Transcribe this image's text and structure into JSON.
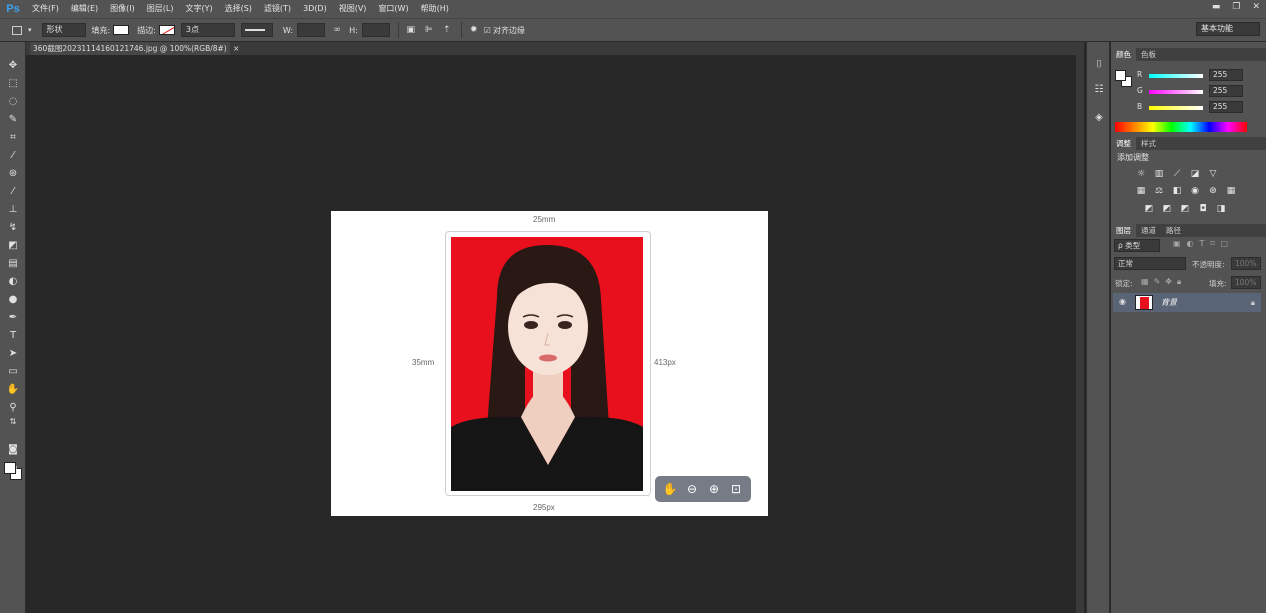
{
  "app": {
    "logo": "Ps"
  },
  "menu": [
    "文件(F)",
    "编辑(E)",
    "图像(I)",
    "图层(L)",
    "文字(Y)",
    "选择(S)",
    "滤镜(T)",
    "3D(D)",
    "视图(V)",
    "窗口(W)",
    "帮助(H)"
  ],
  "window_controls": {
    "minimize": "▬",
    "restore": "❐",
    "close": "✕"
  },
  "options": {
    "mode": "形状",
    "fill_label": "填充:",
    "stroke_label": "描边:",
    "stroke_size": "3点",
    "w_label": "W:",
    "h_label": "H:",
    "align_edges_label": "对齐边缘",
    "workspace": "基本功能"
  },
  "document": {
    "tab_title": "360截图20231114160121746.jpg @ 100%(RGB/8#)",
    "tab_close": "×",
    "top_dim": "25mm",
    "left_dim": "35mm",
    "right_dim": "413px",
    "bottom_dim": "295px"
  },
  "zoom_tools": [
    "hand-icon",
    "zoom-out-icon",
    "zoom-in-icon",
    "fit-icon"
  ],
  "panels": {
    "color_tabs": [
      "颜色",
      "色板"
    ],
    "color": {
      "channels": [
        {
          "label": "R",
          "value": "255",
          "gradient": "linear-gradient(to right,#00ffff,#ffffff)"
        },
        {
          "label": "G",
          "value": "255",
          "gradient": "linear-gradient(to right,#ff00ff,#ffffff)"
        },
        {
          "label": "B",
          "value": "255",
          "gradient": "linear-gradient(to right,#ffff00,#ffffff)"
        }
      ]
    },
    "adjust_tabs": [
      "调整",
      "样式"
    ],
    "adjust_title": "添加调整",
    "layers_tabs": [
      "图层",
      "通道",
      "路径"
    ],
    "layers": {
      "kind_filter": "ρ 类型",
      "blend_mode": "正常",
      "opacity_label": "不透明度:",
      "opacity_value": "100%",
      "lock_label": "锁定:",
      "fill_label": "填充:",
      "fill_value": "100%",
      "items": [
        {
          "name": "背景"
        }
      ]
    }
  },
  "colors": {
    "photo_bg": "#e8101d",
    "selected_layer": "#596476",
    "accent_logo": "#3ba3f0"
  }
}
